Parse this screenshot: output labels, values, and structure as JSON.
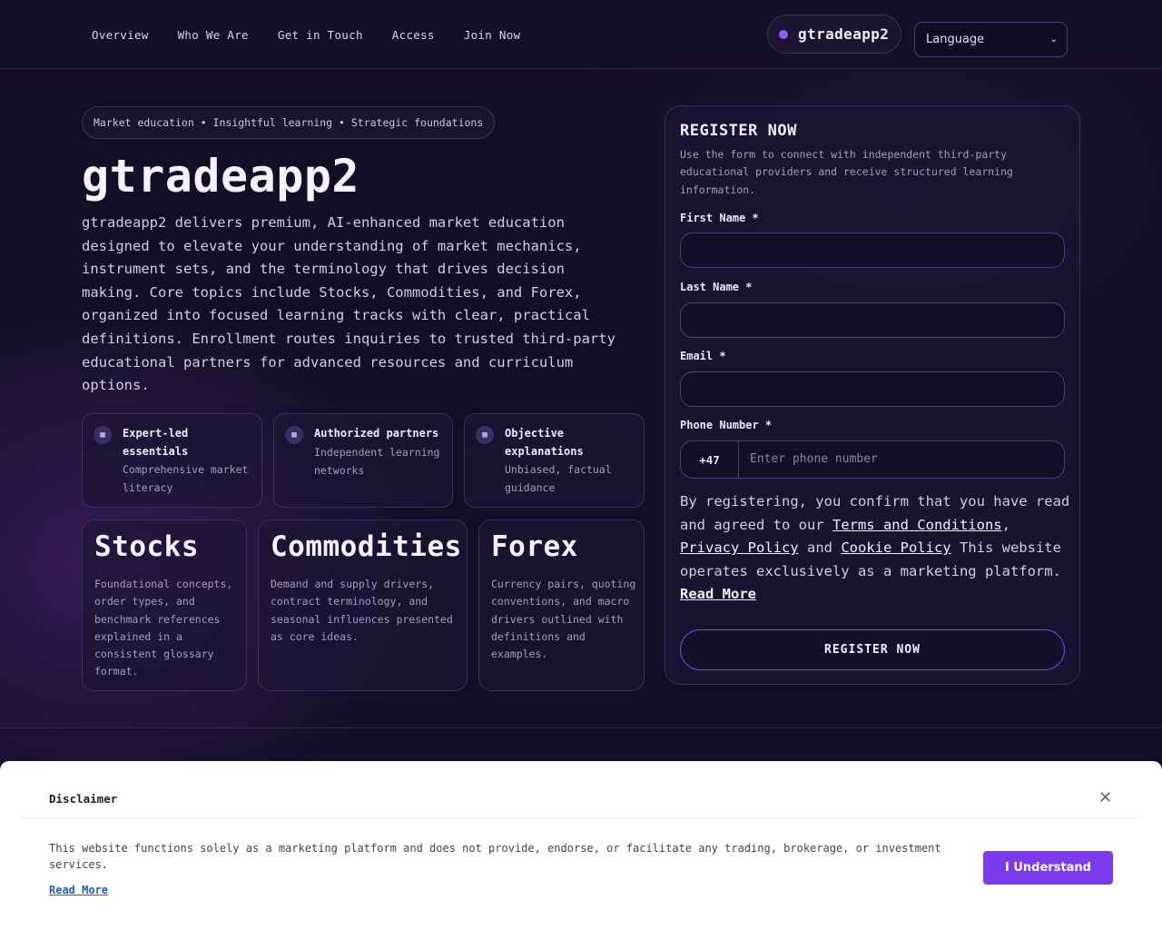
{
  "nav": {
    "items": [
      "Overview",
      "Who We Are",
      "Get in Touch",
      "Access",
      "Join Now"
    ],
    "brand": "gtradeapp2",
    "language_label": "Language"
  },
  "hero": {
    "tagline": "Market education • Insightful learning • Strategic foundations",
    "title": "gtradeapp2",
    "description": "gtradeapp2 delivers premium, AI-enhanced market education designed to elevate your understanding of market mechanics, instrument sets, and the terminology that drives decision making. Core topics include Stocks, Commodities, and Forex, organized into focused learning tracks with clear, practical definitions. Enrollment routes inquiries to trusted third-party educational partners for advanced resources and curriculum options."
  },
  "features": [
    {
      "title": "Expert-led essentials",
      "subtitle": "Comprehensive market literacy",
      "icon": "building-icon"
    },
    {
      "title": "Authorized partners",
      "subtitle": "Independent learning networks",
      "icon": "building-icon"
    },
    {
      "title": "Objective explanations",
      "subtitle": "Unbiased, factual guidance",
      "icon": "building-icon"
    }
  ],
  "topics": [
    {
      "title": "Stocks",
      "text": "Foundational concepts, order types, and benchmark references explained in a consistent glossary format."
    },
    {
      "title": "Commodities",
      "text": "Demand and supply drivers, contract terminology, and seasonal influences presented as core ideas."
    },
    {
      "title": "Forex",
      "text": "Currency pairs, quoting conventions, and macro drivers outlined with definitions and examples."
    }
  ],
  "form": {
    "title": "REGISTER NOW",
    "intro": "Use the form to connect with independent third-party educational providers and receive structured learning information.",
    "first_name_label": "First Name *",
    "last_name_label": "Last Name *",
    "email_label": "Email *",
    "phone_label": "Phone Number *",
    "phone_code": "+47",
    "phone_placeholder": "Enter phone number",
    "consent_prefix": "By registering, you confirm that you have read and agreed to our ",
    "terms_link": "Terms and Conditions",
    "comma": ",",
    "privacy_link": "Privacy Policy",
    "and_text": " and ",
    "cookie_link": "Cookie Policy",
    "consent_suffix": " This website operates exclusively as a marketing platform. ",
    "read_more_link": "Read More",
    "submit_label": "REGISTER NOW"
  },
  "disclaimer": {
    "title": "Disclaimer",
    "close_icon": "close-icon",
    "text": "This website functions solely as a marketing platform and does not provide, endorse, or facilitate any trading, brokerage, or investment services.",
    "read_more": "Read More",
    "button_label": "I Understand"
  },
  "colors": {
    "background": "#150d26",
    "accent": "#7c3aed",
    "brand_dot": "#8b5cf6"
  }
}
